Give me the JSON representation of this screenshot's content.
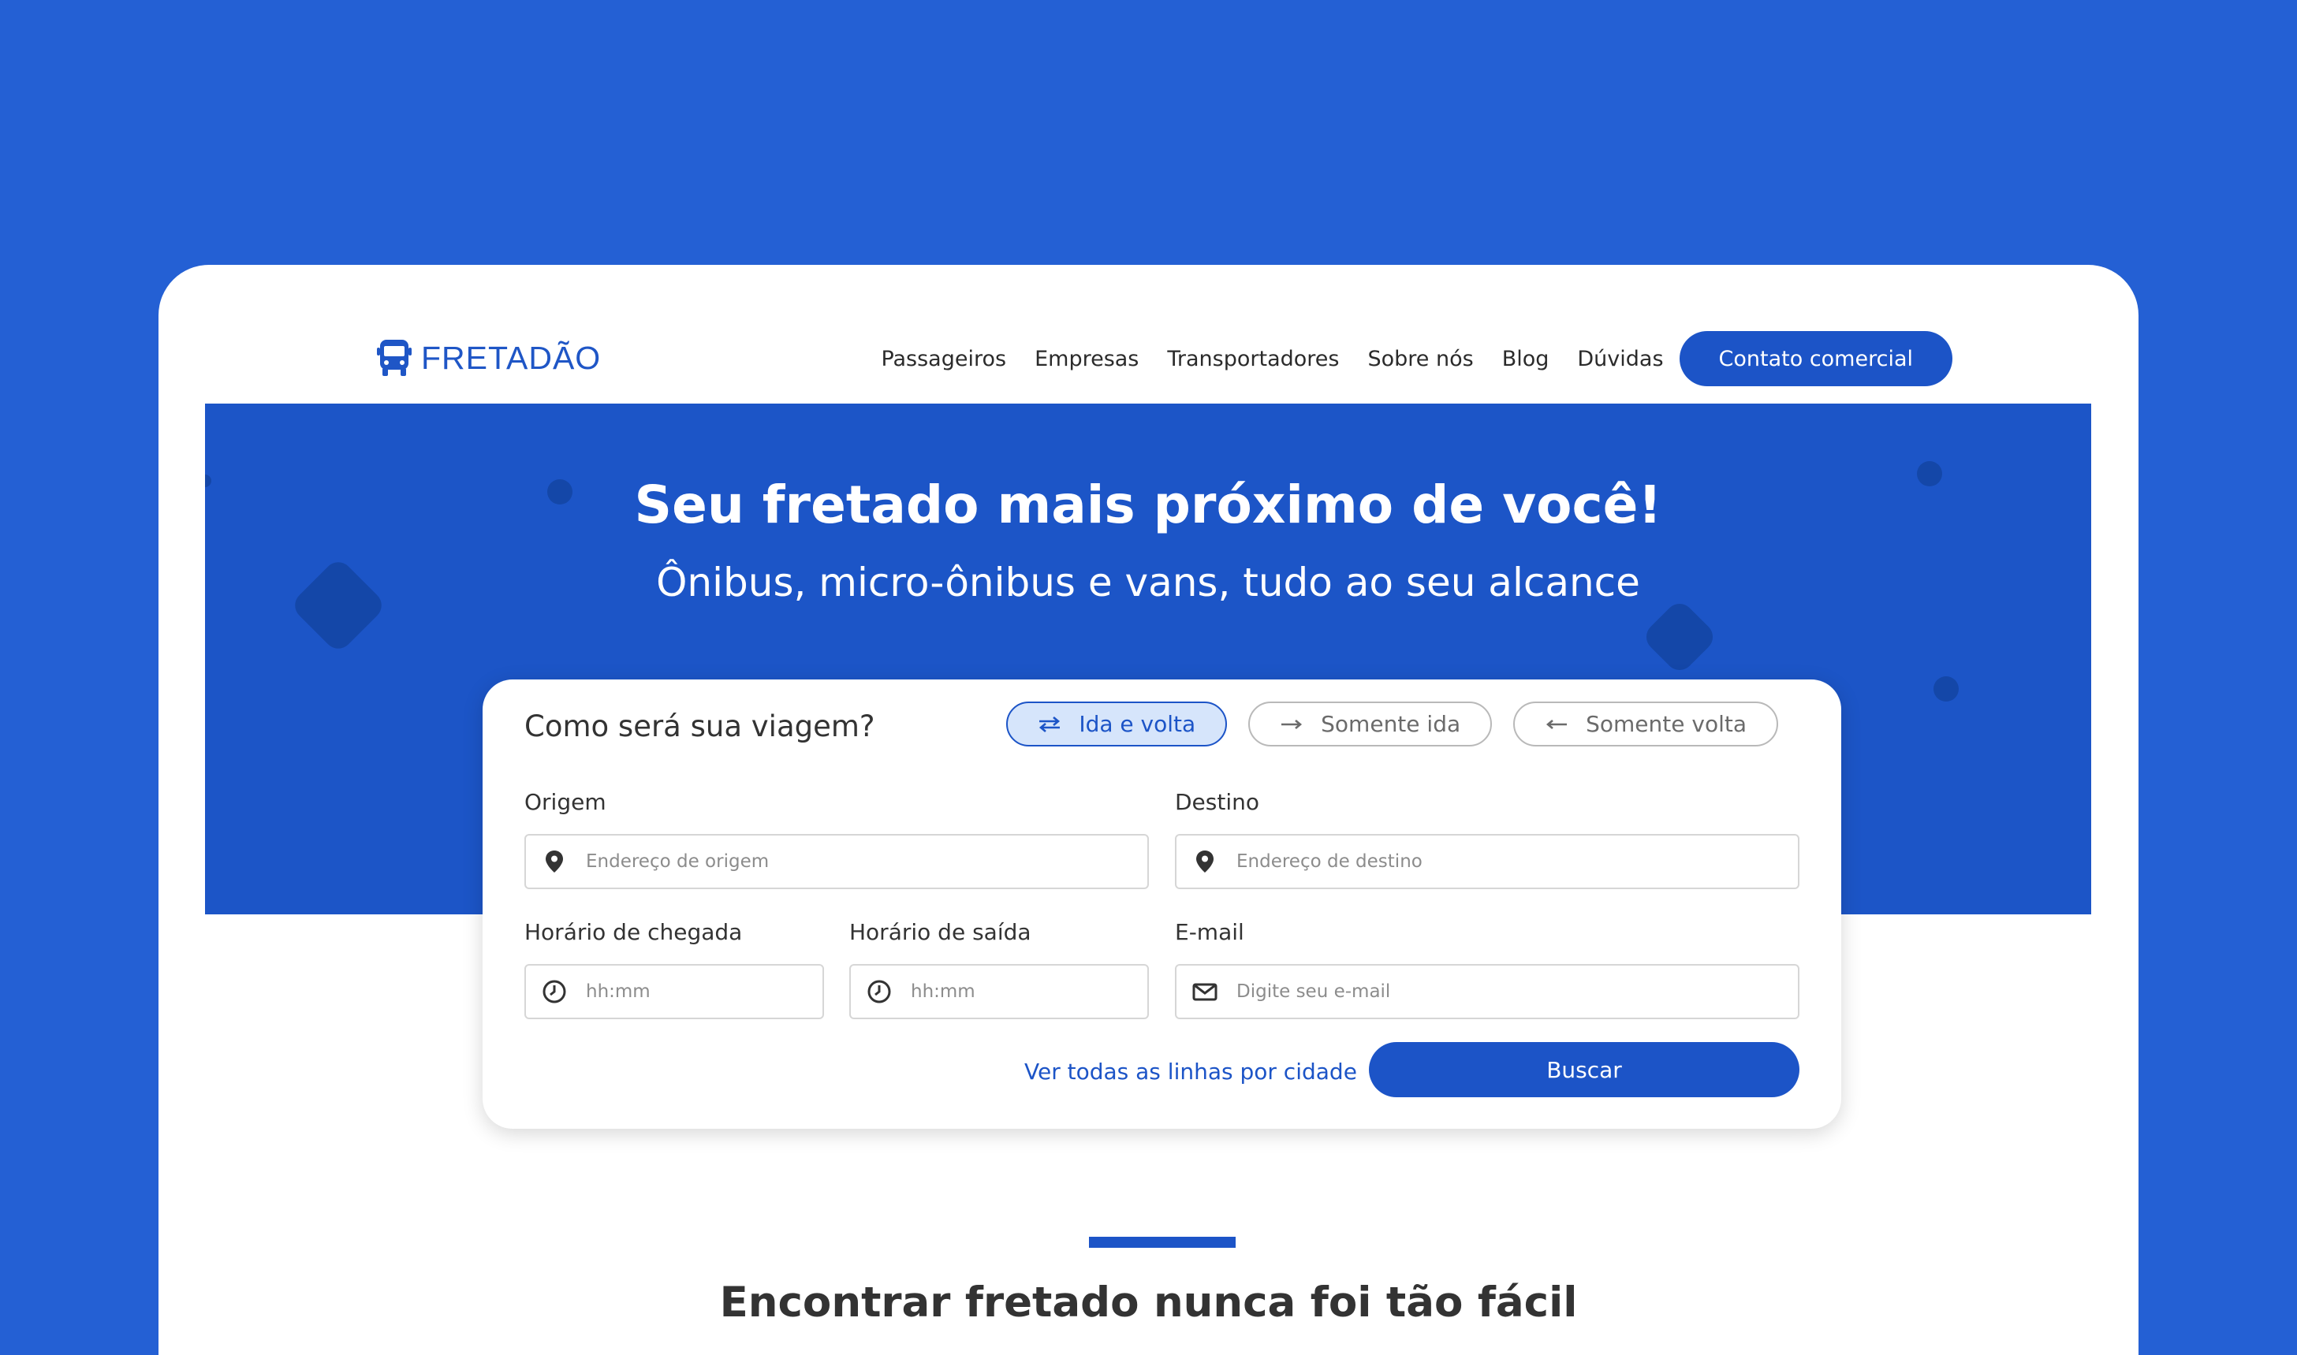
{
  "brand": {
    "name": "FRETADÃO",
    "logo_icon": "bus-icon"
  },
  "nav": {
    "links": [
      "Passageiros",
      "Empresas",
      "Transportadores",
      "Sobre nós",
      "Blog",
      "Dúvidas"
    ],
    "cta": "Contato comercial"
  },
  "hero": {
    "title": "Seu fretado mais próximo de você!",
    "subtitle": "Ônibus, micro-ônibus e vans, tudo ao seu alcance"
  },
  "search": {
    "heading": "Como será sua viagem?",
    "trip_options": [
      {
        "label": "Ida e volta",
        "icon": "swap-arrows-icon",
        "selected": true
      },
      {
        "label": "Somente ida",
        "icon": "arrow-right-icon",
        "selected": false
      },
      {
        "label": "Somente volta",
        "icon": "arrow-left-icon",
        "selected": false
      }
    ],
    "origin": {
      "label": "Origem",
      "placeholder": "Endereço de origem",
      "value": ""
    },
    "destination": {
      "label": "Destino",
      "placeholder": "Endereço de destino",
      "value": ""
    },
    "arrival": {
      "label": "Horário de chegada",
      "placeholder": "hh:mm",
      "value": ""
    },
    "departure": {
      "label": "Horário de saída",
      "placeholder": "hh:mm",
      "value": ""
    },
    "email": {
      "label": "E-mail",
      "placeholder": "Digite seu e-mail",
      "value": ""
    },
    "all_lines_link": "Ver todas as linhas por cidade",
    "search_button": "Buscar"
  },
  "section": {
    "title": "Encontrar fretado nunca foi tão fácil"
  },
  "colors": {
    "background": "#2460d4",
    "primary": "#1c54c7",
    "hero": "#1c55c7",
    "selected_option_bg": "#d6e5fb"
  }
}
